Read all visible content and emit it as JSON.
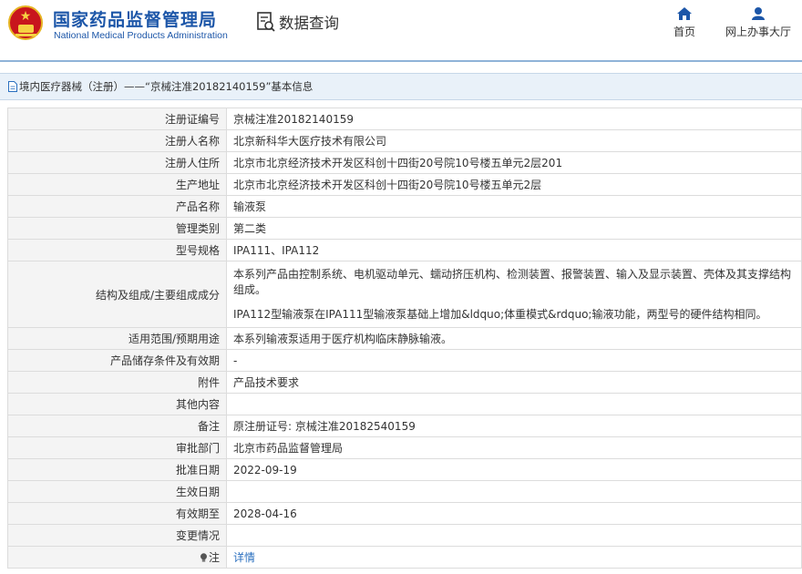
{
  "header": {
    "brand_cn": "国家药品监督管理局",
    "brand_en": "National Medical Products Administration",
    "query_label": "数据查询",
    "nav": [
      {
        "label": "首页",
        "icon": "home-icon"
      },
      {
        "label": "网上办事大厅",
        "icon": "user-icon"
      }
    ]
  },
  "breadcrumb": "境内医疗器械（注册）——“京械注准20182140159”基本信息",
  "rows": [
    {
      "label": "注册证编号",
      "value": "京械注准20182140159"
    },
    {
      "label": "注册人名称",
      "value": "北京新科华大医疗技术有限公司"
    },
    {
      "label": "注册人住所",
      "value": "北京市北京经济技术开发区科创十四街20号院10号楼五单元2层201"
    },
    {
      "label": "生产地址",
      "value": "北京市北京经济技术开发区科创十四街20号院10号楼五单元2层"
    },
    {
      "label": "产品名称",
      "value": "输液泵"
    },
    {
      "label": "管理类别",
      "value": "第二类"
    },
    {
      "label": "型号规格",
      "value": "IPA111、IPA112"
    },
    {
      "label": "结构及组成/主要组成成分",
      "value_line1": "本系列产品由控制系统、电机驱动单元、蠕动挤压机构、检测装置、报警装置、输入及显示装置、壳体及其支撑结构组成。",
      "value_line2": "IPA112型输液泵在IPA111型输液泵基础上增加&ldquo;体重模式&rdquo;输液功能，两型号的硬件结构相同。"
    },
    {
      "label": "适用范围/预期用途",
      "value": "本系列输液泵适用于医疗机构临床静脉输液。"
    },
    {
      "label": "产品储存条件及有效期",
      "value": "-"
    },
    {
      "label": "附件",
      "value": "产品技术要求"
    },
    {
      "label": "其他内容",
      "value": ""
    },
    {
      "label": "备注",
      "value": "原注册证号: 京械注准20182540159"
    },
    {
      "label": "审批部门",
      "value": "北京市药品监督管理局"
    },
    {
      "label": "批准日期",
      "value": "2022-09-19"
    },
    {
      "label": "生效日期",
      "value": ""
    },
    {
      "label": "有效期至",
      "value": "2028-04-16"
    },
    {
      "label": "变更情况",
      "value": ""
    },
    {
      "label": "注",
      "value": "详情",
      "icon": "lightbulb-icon"
    }
  ],
  "colors": {
    "brand_blue": "#1c56a8",
    "emblem_red": "#c8161d",
    "emblem_gold": "#f5d142",
    "crumb_bg": "#e9f1f9",
    "label_bg": "#f4f4f4",
    "link_blue": "#2a6fbf"
  }
}
